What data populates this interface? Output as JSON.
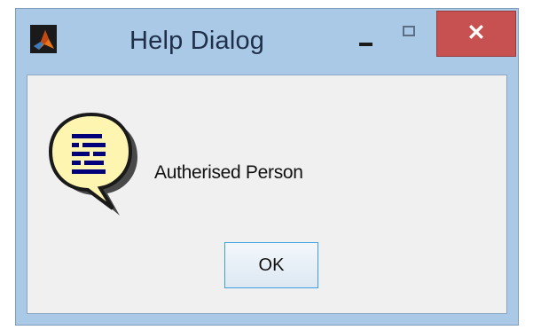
{
  "window": {
    "title": "Help Dialog",
    "app_icon": "matlab-logo-icon",
    "controls": {
      "minimize_icon": "minimize-icon",
      "maximize_icon": "maximize-icon",
      "close_label": "✕"
    }
  },
  "body": {
    "icon": "help-speech-bubble-icon",
    "message": "Autherised Person"
  },
  "buttons": {
    "ok_label": "OK"
  },
  "colors": {
    "titlebar": "#a9c9e6",
    "close_button": "#c75050",
    "client_background": "#f0f0f0",
    "bubble_fill": "#fdf5b0",
    "icon_lines": "#00007a"
  }
}
